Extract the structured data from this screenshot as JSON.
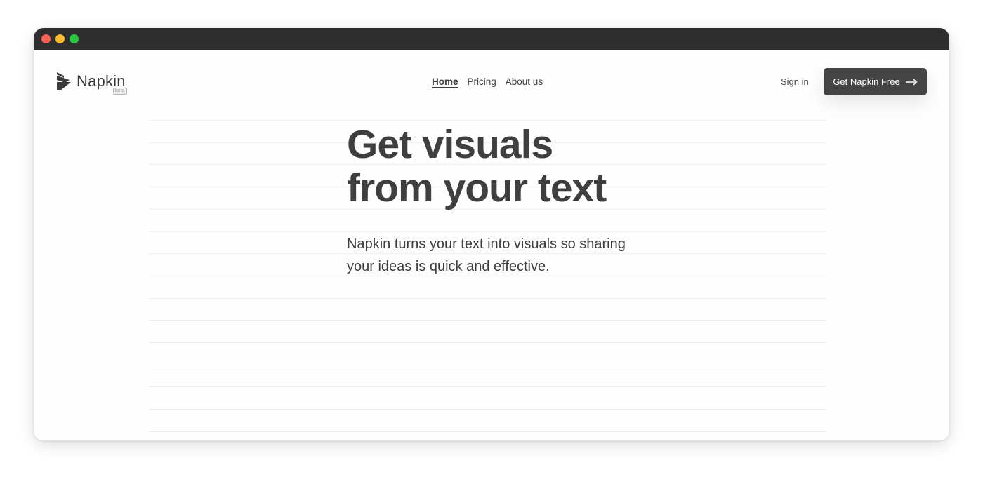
{
  "window": {
    "controls": [
      {
        "name": "close",
        "color": "#ff5f57"
      },
      {
        "name": "minimize",
        "color": "#febc2e"
      },
      {
        "name": "zoom",
        "color": "#28c840"
      }
    ]
  },
  "header": {
    "logo": {
      "icon": "napkin-logo-icon",
      "text": "Napkin",
      "badge": "beta"
    },
    "nav": [
      {
        "label": "Home",
        "active": true
      },
      {
        "label": "Pricing",
        "active": false
      },
      {
        "label": "About us",
        "active": false
      }
    ],
    "sign_in": "Sign in",
    "cta": {
      "label": "Get Napkin Free",
      "icon": "arrow-right-icon",
      "color": "#444444"
    }
  },
  "hero": {
    "title_lines": [
      "Get visuals",
      "from your text"
    ],
    "subtitle": "Napkin turns your text into visuals so sharing your ideas is quick and effective."
  }
}
